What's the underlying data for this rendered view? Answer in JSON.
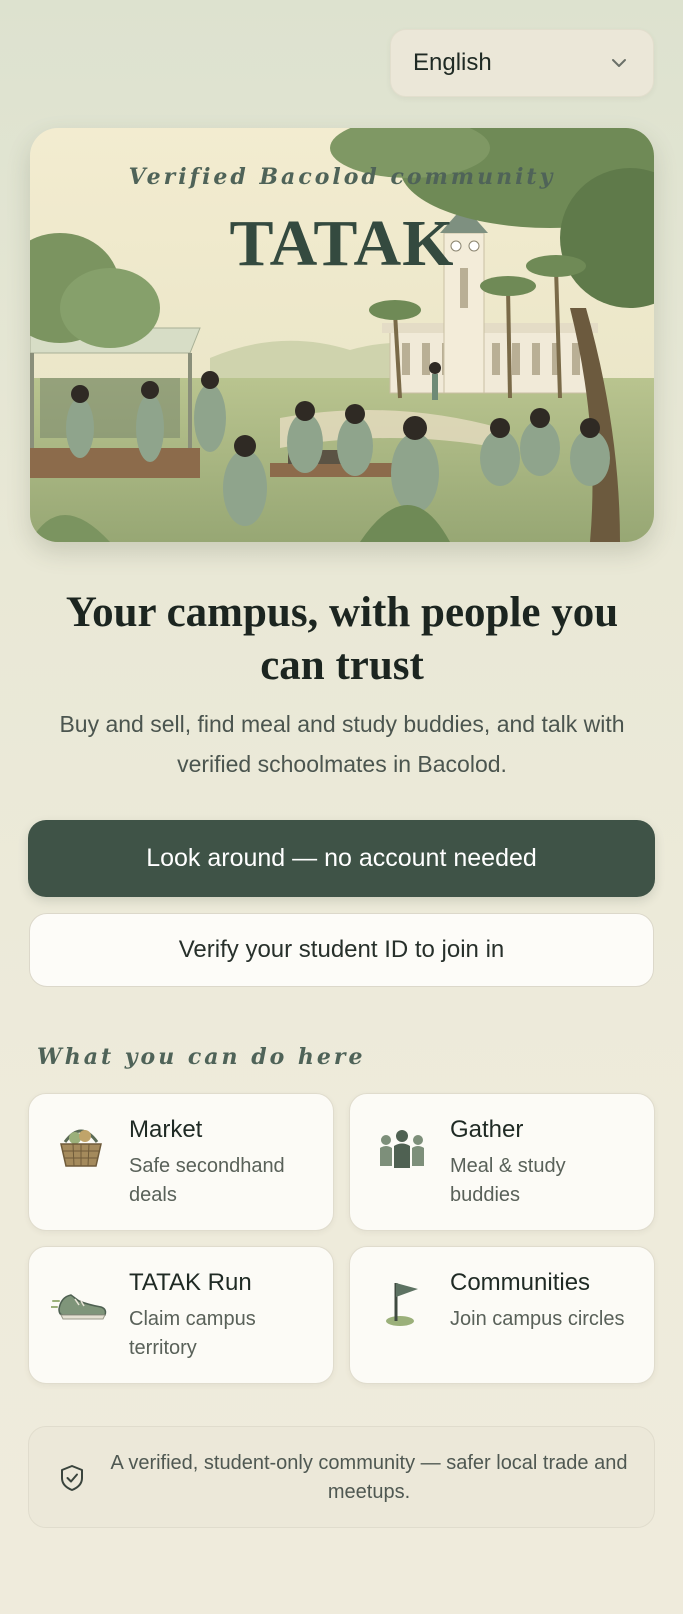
{
  "language_selector": {
    "label": "English",
    "icon": "chevron-down-icon"
  },
  "hero": {
    "tagline": "Verified Bacolod community",
    "title": "TATAK",
    "illustration": "campus-illustration"
  },
  "headline": "Your campus, with people you can trust",
  "subheadline": "Buy and sell, find meal and study buddies, and talk with verified schoolmates in Bacolod.",
  "actions": {
    "primary_label": "Look around — no account needed",
    "secondary_label": "Verify your student ID to join in"
  },
  "features_section": {
    "title": "What you can do here",
    "items": [
      {
        "title": "Market",
        "description": "Safe secondhand deals",
        "icon": "basket-icon"
      },
      {
        "title": "Gather",
        "description": "Meal & study buddies",
        "icon": "people-group-icon"
      },
      {
        "title": "TATAK Run",
        "description": "Claim campus territory",
        "icon": "running-shoe-icon"
      },
      {
        "title": "Communities",
        "description": "Join campus circles",
        "icon": "flag-icon"
      }
    ]
  },
  "trust_note": {
    "text": "A verified, student-only community — safer local trade and meetups.",
    "icon": "shield-check-icon"
  },
  "colors": {
    "primary": "#3f5347",
    "accent_text": "#4f6358",
    "background": "#ebe8d8",
    "card": "#fcfbf6"
  }
}
